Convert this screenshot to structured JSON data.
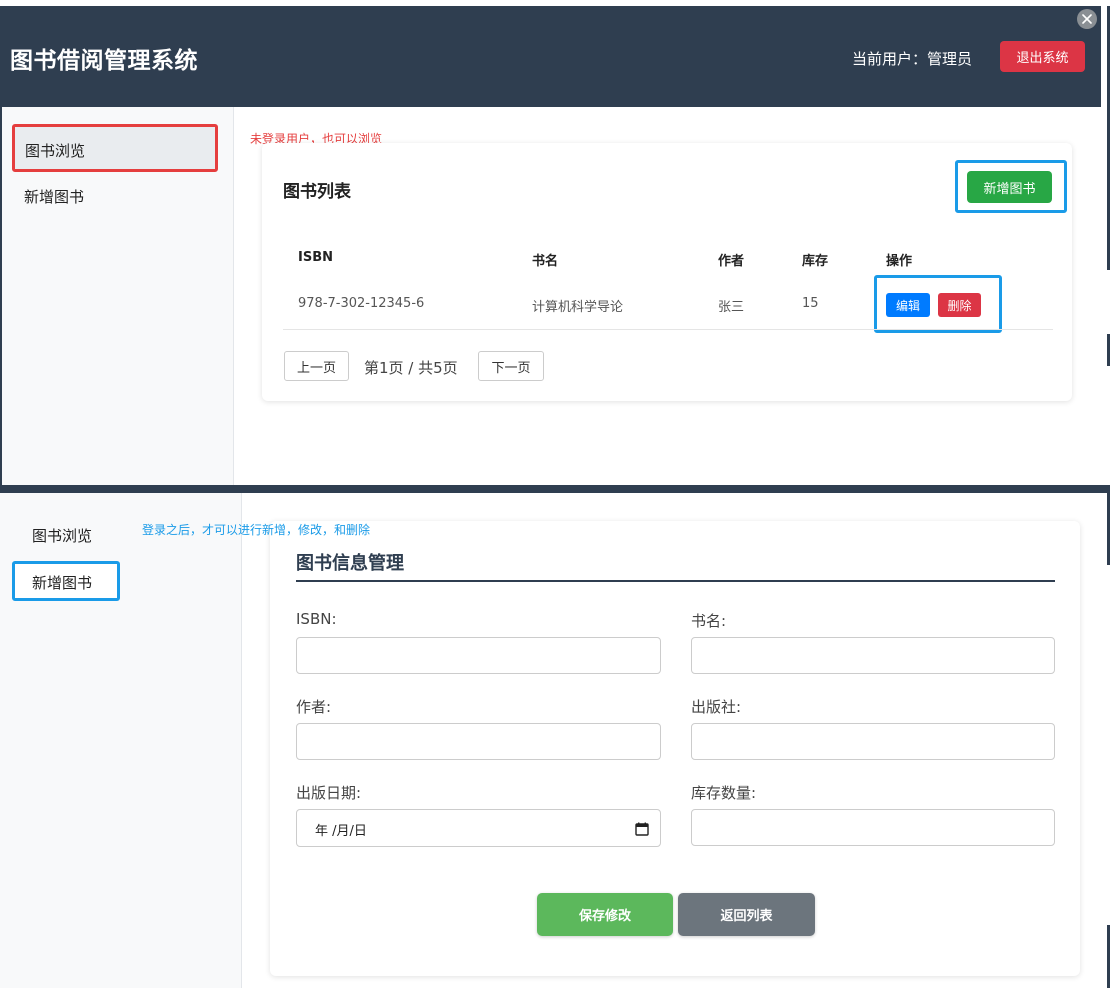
{
  "header": {
    "app_title": "图书借阅管理系统",
    "current_user": "当前用户：管理员",
    "logout_label": "退出系统"
  },
  "sidebar": {
    "items": [
      {
        "label": "图书浏览"
      },
      {
        "label": "新增图书"
      }
    ]
  },
  "annotations": {
    "guest_note": "未登录用户，也可以浏览",
    "login_note": "登录之后，才可以进行新增，修改，和删除"
  },
  "book_list": {
    "title": "图书列表",
    "add_label": "新增图书",
    "columns": [
      "ISBN",
      "书名",
      "作者",
      "库存",
      "操作"
    ],
    "rows": [
      {
        "isbn": "978-7-302-12345-6",
        "name": "计算机科学导论",
        "author": "张三",
        "stock": "15",
        "edit_label": "编辑",
        "delete_label": "删除"
      }
    ],
    "pagination": {
      "prev_label": "上一页",
      "status": "第1页 / 共5页",
      "next_label": "下一页"
    }
  },
  "form": {
    "title": "图书信息管理",
    "fields": {
      "isbn": {
        "label": "ISBN:",
        "value": ""
      },
      "name": {
        "label": "书名:",
        "value": ""
      },
      "author": {
        "label": "作者:",
        "value": ""
      },
      "publisher": {
        "label": "出版社:",
        "value": ""
      },
      "publish_date": {
        "label": "出版日期:",
        "display": "年 /月/日"
      },
      "stock": {
        "label": "库存数量:",
        "value": ""
      }
    },
    "save_label": "保存修改",
    "back_label": "返回列表"
  },
  "colors": {
    "header_bg": "#2f3e50",
    "danger": "#dc3545",
    "success": "#28a745",
    "primary": "#007bff",
    "highlight_blue": "#1a9be8",
    "highlight_red": "#e53e3e"
  },
  "icons": {
    "close": "close-icon",
    "calendar": "calendar-icon"
  }
}
